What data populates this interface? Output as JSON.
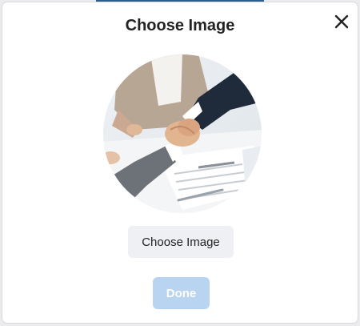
{
  "dialog": {
    "title": "Choose Image",
    "close_icon": "close-icon",
    "image_preview": {
      "shape": "circle",
      "depicts": "handshake-over-contract-photo"
    },
    "choose_button_label": "Choose Image",
    "done_button_label": "Done",
    "done_button_state": "disabled"
  },
  "colors": {
    "modal_background": "#ffffff",
    "choose_button_bg": "#eef0f4",
    "done_button_bg_disabled": "#b9d4f0",
    "done_button_text": "#ffffff",
    "title_text": "#222222"
  }
}
